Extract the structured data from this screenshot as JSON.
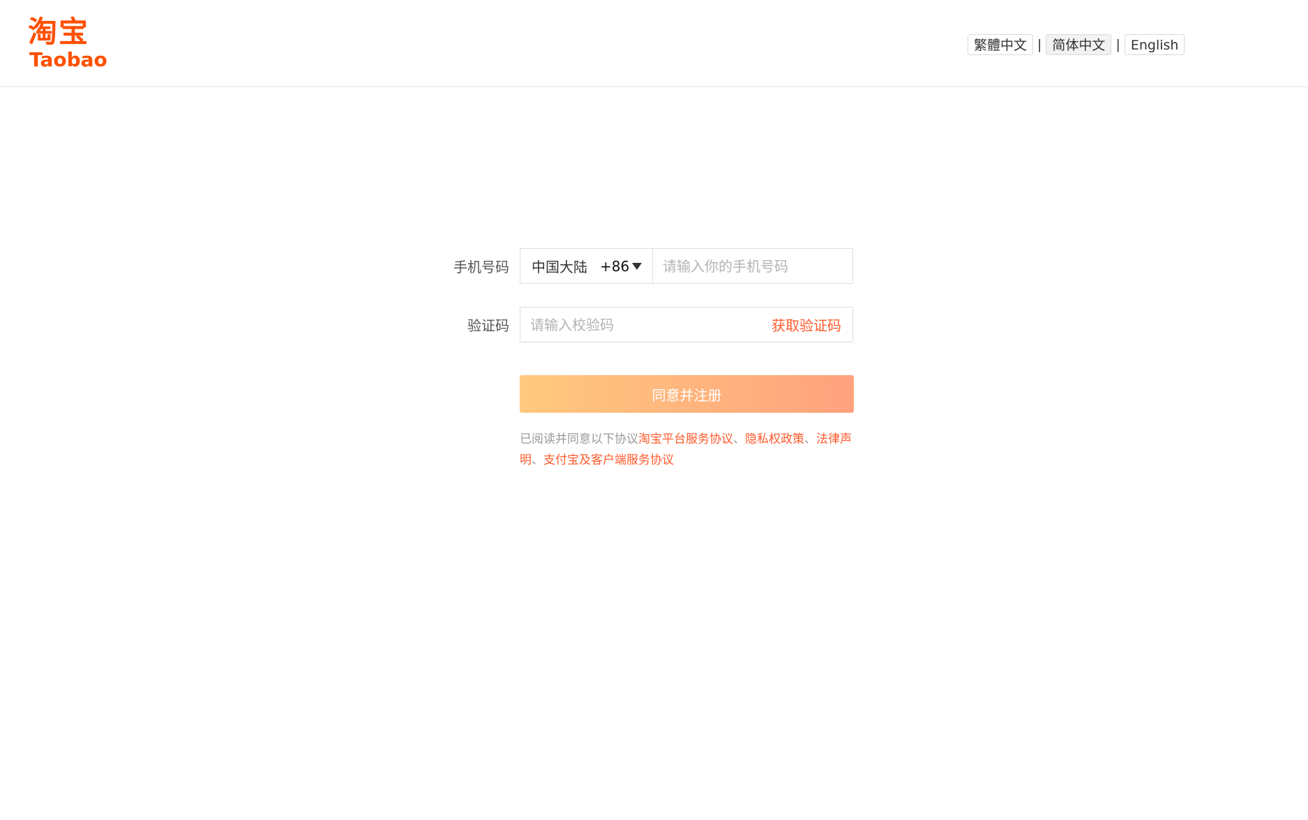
{
  "header": {
    "logo_cn": "淘宝",
    "logo_en": "Taobao",
    "languages": [
      {
        "label": "繁體中文"
      },
      {
        "label": "简体中文"
      },
      {
        "label": "English"
      }
    ],
    "separator": "|"
  },
  "form": {
    "phone": {
      "label": "手机号码",
      "region_name": "中国大陆",
      "region_code": "+86",
      "placeholder": "请输入你的手机号码"
    },
    "code": {
      "label": "验证码",
      "placeholder": "请输入校验码",
      "get_code_label": "获取验证码"
    },
    "submit_label": "同意并注册"
  },
  "agreement": {
    "prefix": "已阅读并同意以下协议",
    "links": [
      "淘宝平台服务协议",
      "隐私权政策",
      "法律声明",
      "支付宝及客户端服务协议"
    ],
    "separator": "、"
  },
  "colors": {
    "brand": "#ff5000",
    "link": "#ff5a2c",
    "button_gradient_start": "#ffc97e",
    "button_gradient_end": "#ffa27e"
  }
}
